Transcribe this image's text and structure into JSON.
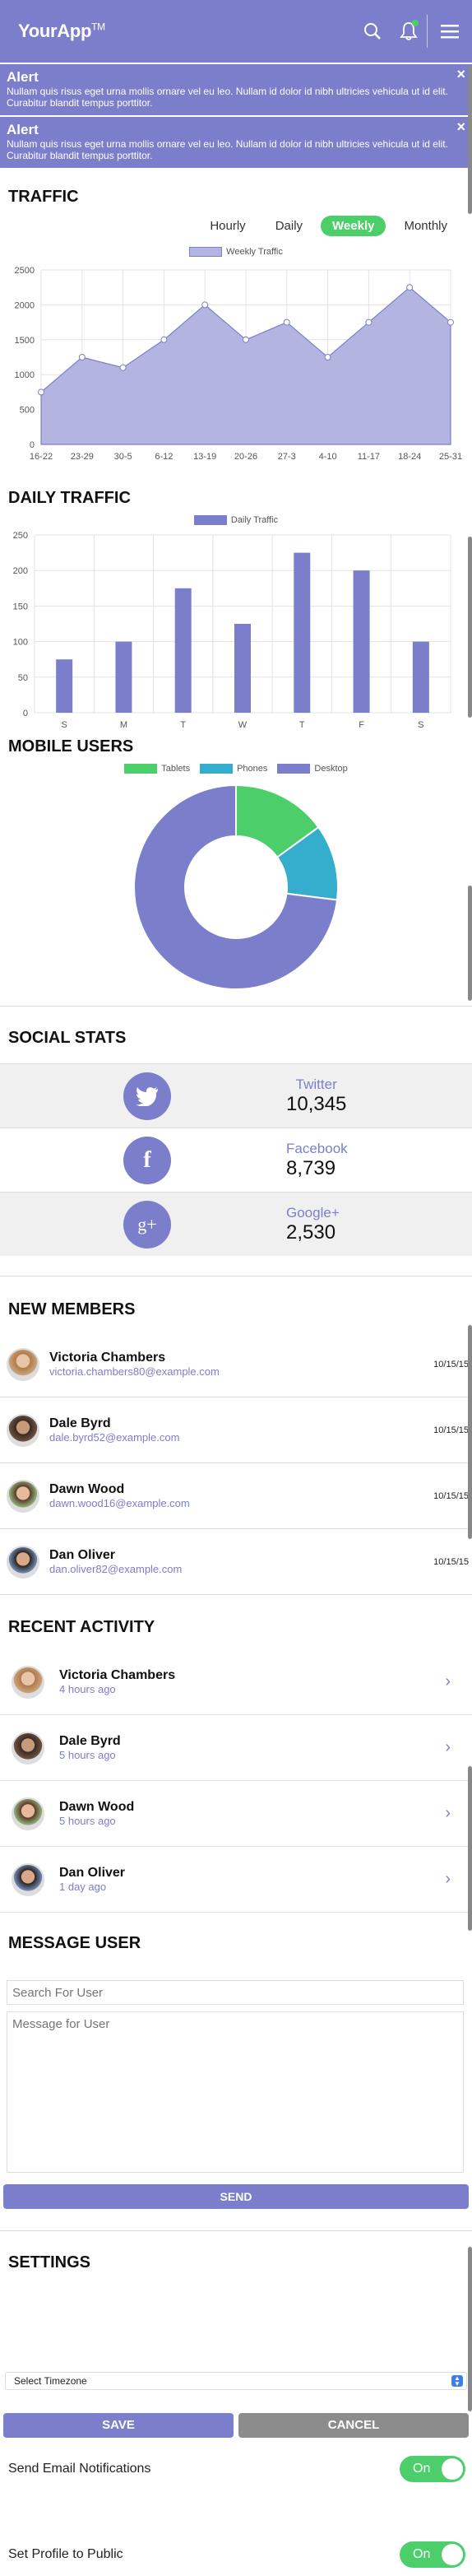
{
  "app": {
    "name": "YourApp",
    "tm": "TM"
  },
  "header": {
    "icons": [
      "search-icon",
      "bell-icon",
      "menu-icon"
    ]
  },
  "alerts": [
    {
      "title": "Alert",
      "text": "Nullam quis risus eget urna mollis ornare vel eu leo. Nullam id dolor id nibh ultricies vehicula ut id elit. Curabitur blandit tempus porttitor.",
      "close": "×"
    },
    {
      "title": "Alert",
      "text": "Nullam quis risus eget urna mollis ornare vel eu leo. Nullam id dolor id nibh ultricies vehicula ut id elit. Curabitur blandit tempus porttitor.",
      "close": "×"
    }
  ],
  "traffic": {
    "title": "TRAFFIC",
    "tabs": [
      {
        "label": "Hourly"
      },
      {
        "label": "Daily"
      },
      {
        "label": "Weekly",
        "active": true
      },
      {
        "label": "Monthly"
      }
    ]
  },
  "daily": {
    "title": "DAILY TRAFFIC"
  },
  "mobile": {
    "title": "MOBILE USERS"
  },
  "chart_data": [
    {
      "type": "area",
      "legend": [
        "Weekly Traffic"
      ],
      "categories": [
        "16-22",
        "23-29",
        "30-5",
        "6-12",
        "13-19",
        "20-26",
        "27-3",
        "4-10",
        "11-17",
        "18-24",
        "25-31"
      ],
      "series": [
        {
          "name": "Weekly Traffic",
          "values": [
            750,
            1250,
            1100,
            1500,
            2000,
            1500,
            1750,
            1250,
            1750,
            2250,
            1750
          ]
        }
      ],
      "yticks": [
        "0",
        "500",
        "1000",
        "1500",
        "2000",
        "2500"
      ],
      "ylim": [
        0,
        2500
      ],
      "color": "#b3b5e0",
      "grid": true
    },
    {
      "type": "bar",
      "legend": [
        "Daily Traffic"
      ],
      "categories": [
        "S",
        "M",
        "T",
        "W",
        "T",
        "F",
        "S"
      ],
      "series": [
        {
          "name": "Daily Traffic",
          "values": [
            75,
            100,
            175,
            125,
            225,
            200,
            100
          ]
        }
      ],
      "yticks": [
        "0",
        "50",
        "100",
        "150",
        "200",
        "250"
      ],
      "ylim": [
        0,
        250
      ],
      "color": "#7b7fcb",
      "grid": true
    },
    {
      "type": "pie",
      "donut": true,
      "legend": [
        "Tablets",
        "Phones",
        "Desktop"
      ],
      "labels": [
        "Tablets",
        "Phones",
        "Desktop"
      ],
      "values": [
        15,
        12,
        73
      ],
      "colors": [
        "#4ccf6b",
        "#35adcc",
        "#7b7fcb"
      ]
    }
  ],
  "social": {
    "title": "SOCIAL STATS",
    "items": [
      {
        "name": "Twitter",
        "count": "10,345",
        "icon": "twitter-icon"
      },
      {
        "name": "Facebook",
        "count": "8,739",
        "icon": "facebook-icon"
      },
      {
        "name": "Google+",
        "count": "2,530",
        "icon": "google-plus-icon"
      }
    ]
  },
  "members": {
    "title": "NEW MEMBERS",
    "items": [
      {
        "name": "Victoria Chambers",
        "email": "victoria.chambers80@example.com",
        "date": "10/15/15"
      },
      {
        "name": "Dale Byrd",
        "email": "dale.byrd52@example.com",
        "date": "10/15/15"
      },
      {
        "name": "Dawn Wood",
        "email": "dawn.wood16@example.com",
        "date": "10/15/15"
      },
      {
        "name": "Dan Oliver",
        "email": "dan.oliver82@example.com",
        "date": "10/15/15"
      }
    ]
  },
  "activity": {
    "title": "RECENT ACTIVITY",
    "items": [
      {
        "name": "Victoria Chambers",
        "time": "4 hours ago"
      },
      {
        "name": "Dale Byrd",
        "time": "5 hours ago"
      },
      {
        "name": "Dawn Wood",
        "time": "5 hours ago"
      },
      {
        "name": "Dan Oliver",
        "time": "1 day ago"
      }
    ]
  },
  "message": {
    "title": "MESSAGE USER",
    "search_placeholder": "Search For User",
    "message_placeholder": "Message for User",
    "send": "SEND"
  },
  "settings": {
    "title": "SETTINGS",
    "email_label": "Send Email Notifications",
    "email_toggle": "On",
    "public_label": "Set Profile to Public",
    "public_toggle": "On",
    "timezone_label": "Select Timezone",
    "save": "SAVE",
    "cancel": "CANCEL"
  }
}
